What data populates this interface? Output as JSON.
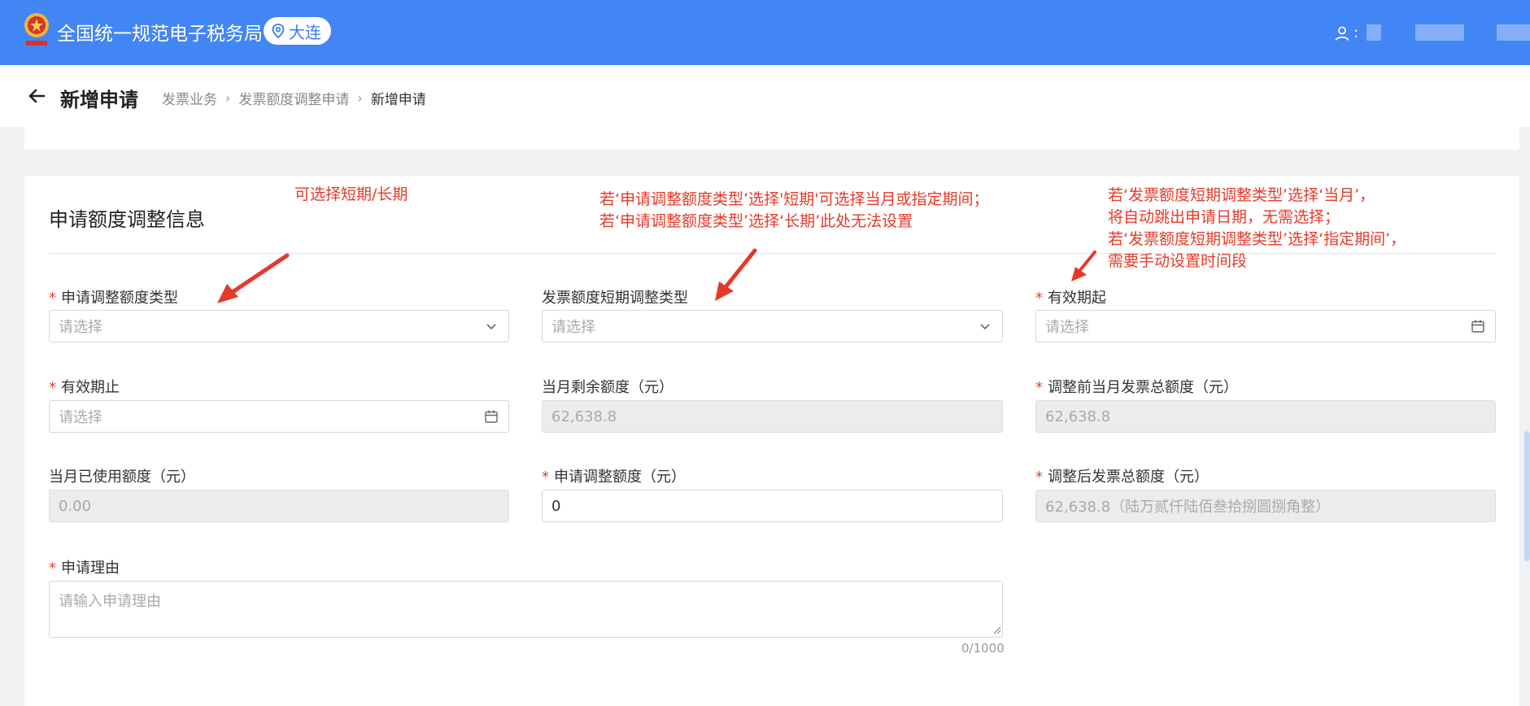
{
  "header": {
    "title": "全国统一规范电子税务局",
    "city": "大连",
    "user_prefix": ":"
  },
  "breadcrumb_bar": {
    "page_title": "新增申请",
    "crumbs": [
      "发票业务",
      "发票额度调整申请",
      "新增申请"
    ]
  },
  "form": {
    "section_title": "申请额度调整信息",
    "fields": {
      "adjust_type": {
        "label": "申请调整额度类型",
        "placeholder": "请选择"
      },
      "short_type": {
        "label": "发票额度短期调整类型",
        "placeholder": "请选择"
      },
      "valid_from": {
        "label": "有效期起",
        "placeholder": "请选择"
      },
      "valid_to": {
        "label": "有效期止",
        "placeholder": "请选择"
      },
      "month_remaining": {
        "label": "当月剩余额度（元）",
        "value": "62,638.8"
      },
      "before_total": {
        "label": "调整前当月发票总额度（元）",
        "value": "62,638.8"
      },
      "month_used": {
        "label": "当月已使用额度（元）",
        "value": "0.00"
      },
      "apply_amount": {
        "label": "申请调整额度（元）",
        "value": "0"
      },
      "after_total": {
        "label": "调整后发票总额度（元）",
        "value": "62,638.8（陆万贰仟陆佰叁拾捌圆捌角整）"
      },
      "reason": {
        "label": "申请理由",
        "placeholder": "请输入申请理由",
        "counter": "0/1000"
      }
    }
  },
  "annotations": {
    "a1": "可选择短期/长期",
    "a2_line1": "若‘申请调整额度类型’选择'短期'可选择当月或指定期间；",
    "a2_line2": "若‘申请调整额度类型’选择‘长期’此处无法设置",
    "a3_line1": "若‘发票额度短期调整类型’选择‘当月’，",
    "a3_line2": "将自动跳出申请日期，无需选择；",
    "a3_line3": "若‘发票额度短期调整类型’选择‘指定期间’，",
    "a3_line4": "需要手动设置时间段"
  },
  "colors": {
    "header_bg": "#4285f4",
    "required_star": "#e0442b",
    "annotation": "#e53a2a"
  }
}
